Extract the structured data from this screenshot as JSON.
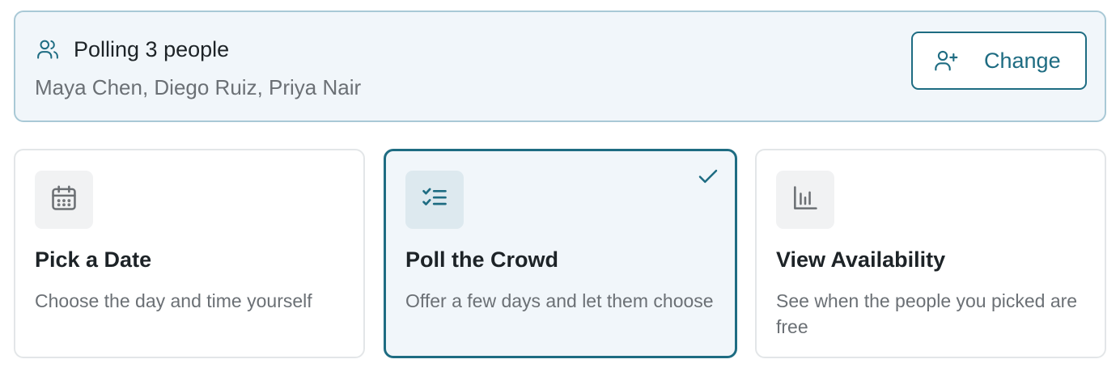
{
  "poll": {
    "title": "Polling 3 people",
    "names": "Maya Chen, Diego Ruiz, Priya Nair",
    "icon": "users-icon",
    "change_label": "Change",
    "change_icon": "user-plus-icon"
  },
  "options": [
    {
      "title": "Pick a Date",
      "description": "Choose the day and time yourself",
      "icon": "calendar-icon",
      "selected": false
    },
    {
      "title": "Poll the Crowd",
      "description": "Offer a few days and let them choose",
      "icon": "checklist-icon",
      "selected": true
    },
    {
      "title": "View Availability",
      "description": "See when the people you picked are free",
      "icon": "bar-chart-icon",
      "selected": false
    }
  ],
  "colors": {
    "accent": "#1e6c82",
    "panel_bg": "#f1f6fa",
    "panel_border": "#a9c9d6",
    "muted_text": "#6b7075",
    "icon_gray": "#6b6f73"
  }
}
